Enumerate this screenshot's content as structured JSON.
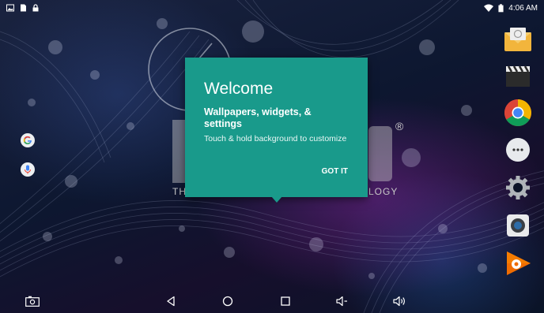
{
  "status_bar": {
    "left_icons": [
      "gallery-icon",
      "sd-card-icon",
      "lock-icon"
    ],
    "right_icons": [
      "wifi-icon",
      "battery-icon"
    ],
    "time": "4:06 AM"
  },
  "wallpaper": {
    "brand_left": "TH",
    "brand_right": "LOGY",
    "registered_mark": "®"
  },
  "welcome_dialog": {
    "title": "Welcome",
    "subtitle": "Wallpapers, widgets, & settings",
    "body": "Touch & hold background to customize",
    "got_it_label": "GOT IT",
    "color": "#199a8b"
  },
  "side_shortcuts": [
    {
      "name": "google-search-icon"
    },
    {
      "name": "voice-search-icon"
    }
  ],
  "dock_apps": [
    {
      "name": "email-app-icon"
    },
    {
      "name": "video-app-icon"
    },
    {
      "name": "chrome-app-icon"
    },
    {
      "name": "app-drawer-icon"
    },
    {
      "name": "settings-app-icon"
    },
    {
      "name": "camera-app-icon"
    },
    {
      "name": "play-music-app-icon"
    }
  ],
  "nav_bar": {
    "icons": [
      "screenshot-icon",
      "back-icon",
      "home-icon",
      "recents-icon",
      "volume-down-icon",
      "volume-up-icon"
    ]
  }
}
